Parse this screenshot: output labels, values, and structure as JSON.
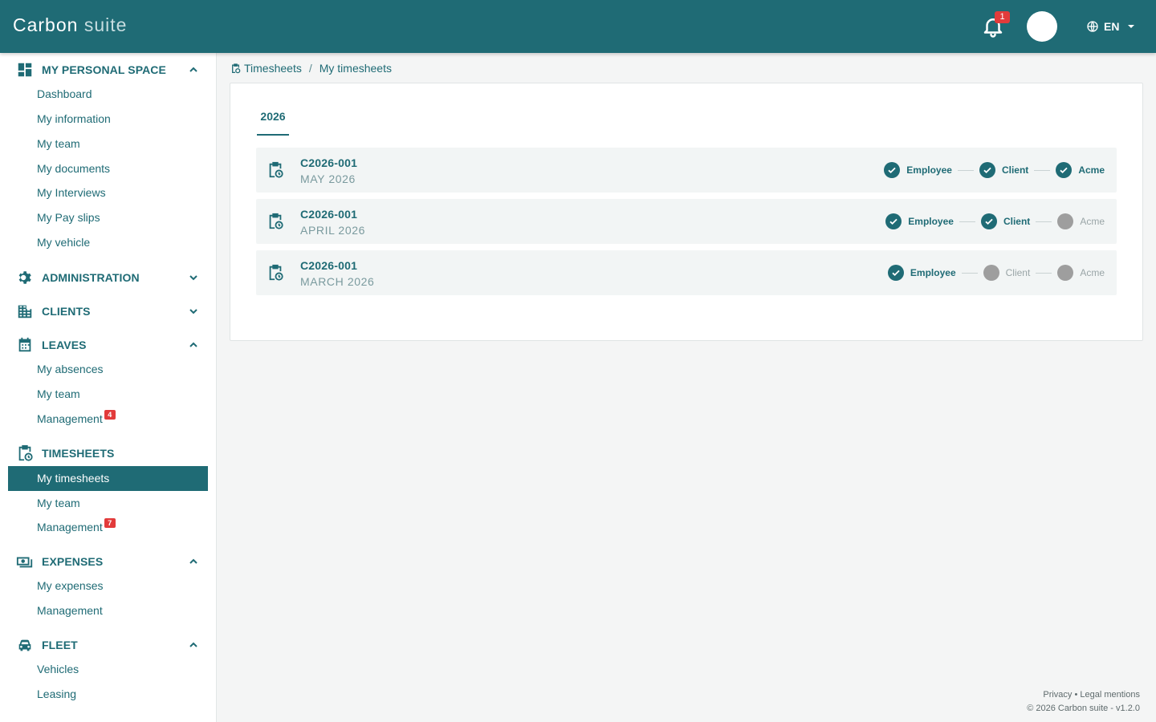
{
  "header": {
    "brand_main": "Carbon",
    "brand_sub": " suite",
    "notification_count": "1",
    "language": "EN",
    "colors": {
      "primary": "#1f6b75",
      "badge": "#e23b3b"
    }
  },
  "sidebar": {
    "sections": [
      {
        "title": "MY PERSONAL SPACE",
        "icon": "dashboard-icon",
        "expanded": true,
        "items": [
          {
            "label": "Dashboard"
          },
          {
            "label": "My information"
          },
          {
            "label": "My team"
          },
          {
            "label": "My documents"
          },
          {
            "label": "My Interviews"
          },
          {
            "label": "My Pay slips"
          },
          {
            "label": "My vehicle"
          }
        ]
      },
      {
        "title": "ADMINISTRATION",
        "icon": "gear-icon",
        "expanded": false,
        "items": []
      },
      {
        "title": "CLIENTS",
        "icon": "building-icon",
        "expanded": false,
        "items": []
      },
      {
        "title": "LEAVES",
        "icon": "calendar-icon",
        "expanded": true,
        "items": [
          {
            "label": "My absences"
          },
          {
            "label": "My team"
          },
          {
            "label": "Management",
            "badge": "4"
          }
        ]
      },
      {
        "title": "TIMESHEETS",
        "icon": "clipboard-clock-icon",
        "expanded": true,
        "items": [
          {
            "label": "My timesheets",
            "active": true
          },
          {
            "label": "My team"
          },
          {
            "label": "Management",
            "badge": "7"
          }
        ]
      },
      {
        "title": "EXPENSES",
        "icon": "cash-icon",
        "expanded": true,
        "items": [
          {
            "label": "My expenses"
          },
          {
            "label": "Management"
          }
        ]
      },
      {
        "title": "FLEET",
        "icon": "car-icon",
        "expanded": true,
        "items": [
          {
            "label": "Vehicles"
          },
          {
            "label": "Leasing"
          }
        ]
      }
    ]
  },
  "breadcrumb": {
    "root": "Timesheets",
    "separator": "/",
    "current": "My timesheets"
  },
  "tabs": [
    {
      "label": "2026",
      "active": true
    }
  ],
  "timesheets": [
    {
      "code": "C2026-001",
      "period": "MAY 2026",
      "steps": [
        {
          "label": "Employee",
          "done": true
        },
        {
          "label": "Client",
          "done": true
        },
        {
          "label": "Acme",
          "done": true
        }
      ]
    },
    {
      "code": "C2026-001",
      "period": "APRIL 2026",
      "steps": [
        {
          "label": "Employee",
          "done": true
        },
        {
          "label": "Client",
          "done": true
        },
        {
          "label": "Acme",
          "done": false
        }
      ]
    },
    {
      "code": "C2026-001",
      "period": "MARCH 2026",
      "steps": [
        {
          "label": "Employee",
          "done": true
        },
        {
          "label": "Client",
          "done": false
        },
        {
          "label": "Acme",
          "done": false
        }
      ]
    }
  ],
  "footer": {
    "links": "Privacy • Legal mentions",
    "copyright": "© 2026 Carbon suite - v1.2.0"
  }
}
